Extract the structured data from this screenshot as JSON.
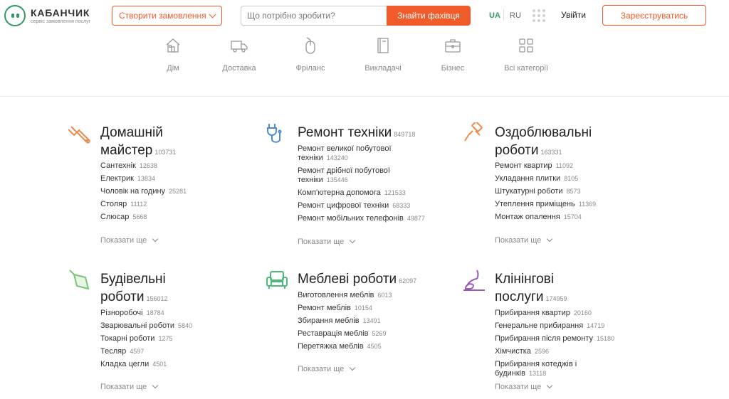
{
  "header": {
    "logo_name": "КАБАНЧИК",
    "logo_tagline": "сервіс замовлення послуг",
    "create_order": "Створити замовлення",
    "search_placeholder": "Що потрібно зробити?",
    "search_button": "Знайти фахівця",
    "lang_ua": "UA",
    "lang_ru": "RU",
    "login": "Увійти",
    "register": "Зареєструватись"
  },
  "nav": [
    {
      "label": "Дім",
      "icon": "house-icon"
    },
    {
      "label": "Доставка",
      "icon": "truck-icon"
    },
    {
      "label": "Фріланс",
      "icon": "mouse-icon"
    },
    {
      "label": "Викладачі",
      "icon": "book-icon"
    },
    {
      "label": "Бізнес",
      "icon": "briefcase-icon"
    },
    {
      "label": "Всі категорії",
      "icon": "grid-icon"
    }
  ],
  "categories": [
    {
      "title_line1": "Домашній",
      "title_line2": "майстер",
      "count": "103731",
      "icon": "wrench-icon",
      "items": [
        {
          "name": "Сантехнік",
          "count": "12638"
        },
        {
          "name": "Електрик",
          "count": "13834"
        },
        {
          "name": "Чоловік на годину",
          "count": "25281"
        },
        {
          "name": "Столяр",
          "count": "11112"
        },
        {
          "name": "Слюсар",
          "count": "5668"
        }
      ],
      "more": "Показати ще"
    },
    {
      "title_line1": "Ремонт техніки",
      "count": "849718",
      "icon": "plug-icon",
      "items": [
        {
          "name": "Ремонт великої побутової",
          "name2": "техніки",
          "count": "143240"
        },
        {
          "name": "Ремонт дрібної побутової",
          "name2": "техніки",
          "count": "135446"
        },
        {
          "name": "Комп'ютерна допомога",
          "count": "121533"
        },
        {
          "name": "Ремонт цифрової техніки",
          "count": "68333"
        },
        {
          "name": "Ремонт мобільних телефонів",
          "count": "49877"
        }
      ],
      "more": "Показати ще"
    },
    {
      "title_line1": "Оздоблювальні",
      "title_line2": "роботи",
      "count": "163331",
      "icon": "paint-roller-icon",
      "items": [
        {
          "name": "Ремонт квартир",
          "count": "11092"
        },
        {
          "name": "Укладання плитки",
          "count": "8105"
        },
        {
          "name": "Штукатурні роботи",
          "count": "8573"
        },
        {
          "name": "Утеплення приміщень",
          "count": "11369"
        },
        {
          "name": "Монтаж опалення",
          "count": "15704"
        }
      ],
      "more": "Показати ще"
    },
    {
      "title_line1": "Будівельні",
      "title_line2": "роботи",
      "count": "156012",
      "icon": "trowel-icon",
      "items": [
        {
          "name": "Різноробочі",
          "count": "18784"
        },
        {
          "name": "Зварювальні роботи",
          "count": "5840"
        },
        {
          "name": "Токарні роботи",
          "count": "1275"
        },
        {
          "name": "Тесляр",
          "count": "4597"
        },
        {
          "name": "Кладка цегли",
          "count": "4501"
        }
      ],
      "more": "Показати ще"
    },
    {
      "title_line1": "Меблеві роботи",
      "count": "62097",
      "icon": "armchair-icon",
      "items": [
        {
          "name": "Виготовлення меблів",
          "count": "6013"
        },
        {
          "name": "Ремонт меблів",
          "count": "10154"
        },
        {
          "name": "Збирання меблів",
          "count": "13491"
        },
        {
          "name": "Реставрація меблів",
          "count": "5269"
        },
        {
          "name": "Перетяжка меблів",
          "count": "4505"
        }
      ],
      "more": "Показати ще"
    },
    {
      "title_line1": "Клінінгові",
      "title_line2": "послуги",
      "count": "174959",
      "icon": "vacuum-icon",
      "items": [
        {
          "name": "Прибирання квартир",
          "count": "20160"
        },
        {
          "name": "Генеральне прибирання",
          "count": "14719"
        },
        {
          "name": "Прибирання після ремонту",
          "count": "15180"
        },
        {
          "name": "Хімчистка",
          "count": "2596"
        },
        {
          "name": "Прибирання котеджів і будинків",
          "count": "13118"
        }
      ],
      "more": "Показати ще"
    }
  ]
}
